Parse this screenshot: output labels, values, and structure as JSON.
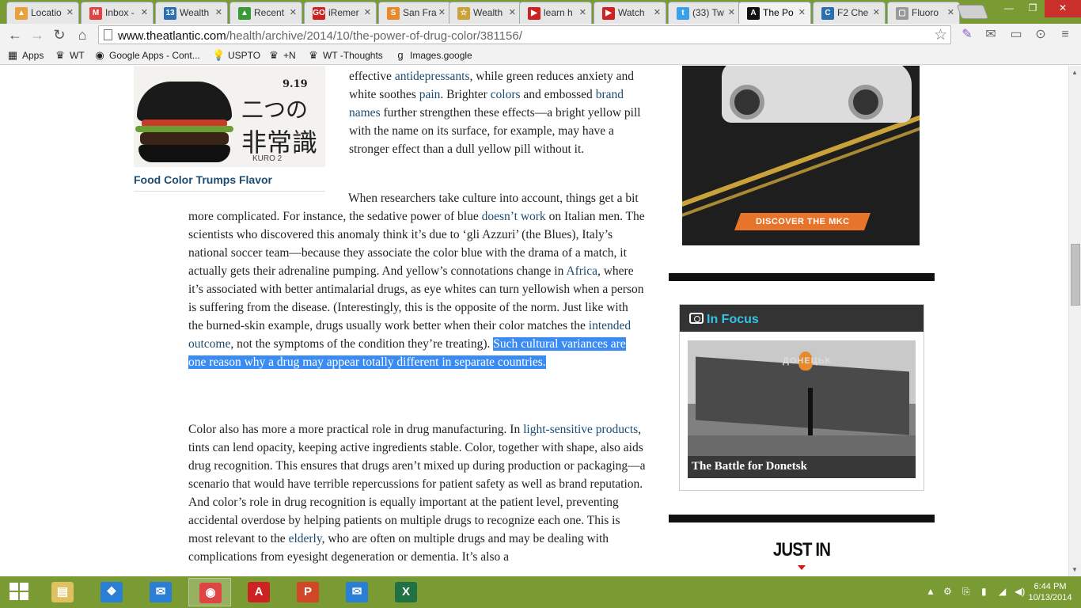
{
  "browser": {
    "tabs": [
      {
        "label": "Locatio",
        "fav_color": "#e8a23a",
        "fav_glyph": "▲"
      },
      {
        "label": "Inbox -",
        "fav_color": "#d44",
        "fav_glyph": "M"
      },
      {
        "label": "Wealth",
        "fav_color": "#2a6fb0",
        "fav_glyph": "13"
      },
      {
        "label": "Recent",
        "fav_color": "#3a9a3a",
        "fav_glyph": "▲"
      },
      {
        "label": "iRemer",
        "fav_color": "#c22",
        "fav_glyph": "GO"
      },
      {
        "label": "San Fra",
        "fav_color": "#e88a2a",
        "fav_glyph": "S"
      },
      {
        "label": "Wealth",
        "fav_color": "#caa23a",
        "fav_glyph": "☆"
      },
      {
        "label": "learn h",
        "fav_color": "#c22",
        "fav_glyph": "▶"
      },
      {
        "label": "Watch",
        "fav_color": "#c22",
        "fav_glyph": "▶"
      },
      {
        "label": "(33) Tw",
        "fav_color": "#3aa0e8",
        "fav_glyph": "t"
      },
      {
        "label": "The Po",
        "fav_color": "#111",
        "fav_glyph": "A",
        "active": true
      },
      {
        "label": "F2 Che",
        "fav_color": "#2a6fb0",
        "fav_glyph": "C"
      },
      {
        "label": "Fluoro",
        "fav_color": "#999",
        "fav_glyph": "▢"
      }
    ],
    "url_host": "www.theatlantic.com",
    "url_path": "/health/archive/2014/10/the-power-of-drug-color/381156/",
    "bookmarks": [
      {
        "label": "Apps",
        "icon": "apps-grid-icon",
        "glyph": "▦"
      },
      {
        "label": "WT",
        "icon": "crown-icon",
        "glyph": "♛"
      },
      {
        "label": "Google Apps - Cont...",
        "icon": "google-icon",
        "glyph": "◉"
      },
      {
        "label": "USPTO",
        "icon": "bulb-icon",
        "glyph": "💡"
      },
      {
        "label": "+N",
        "icon": "crown-icon",
        "glyph": "♛"
      },
      {
        "label": "WT -Thoughts",
        "icon": "crown-icon",
        "glyph": "♛"
      },
      {
        "label": "Images.google",
        "icon": "google-g-icon",
        "glyph": "g"
      }
    ]
  },
  "article": {
    "image_caption": "Food Color Trumps Flavor",
    "image_text": {
      "date": "9.19",
      "line1": "二つの",
      "line2": "非常識",
      "brand": "KURO 2"
    },
    "p1_a": "effective ",
    "p1_link1": "antidepressants",
    "p1_b": ", while green reduces anxiety and white soothes ",
    "p1_link2": "pain",
    "p1_c": ". Brighter ",
    "p1_link3": "colors",
    "p1_d": " and embossed ",
    "p1_link4": "brand names",
    "p1_e": " further strengthen these effects—a bright yellow pill with the name on its surface, for example, may have a stronger effect than a dull yellow pill without it.",
    "p2_a": "When researchers take culture into account, things get a bit more complicated. For instance, the sedative power of blue ",
    "p2_link1": "doesn’t work",
    "p2_b": " on Italian men. The scientists who discovered this anomaly think it’s due to ‘gli Azzuri’ (the Blues), Italy’s national soccer team—because they associate the color blue with the drama of a match, it actually gets their adrenaline pumping. And yellow’s connotations change in ",
    "p2_link2": "Africa",
    "p2_c": ", where it’s associated with better antimalarial drugs, as eye whites can turn yellowish when a person is suffering from the disease. (Interestingly, this is the opposite of the norm. Just like with the burned-skin example, drugs usually work better when their color matches the ",
    "p2_link3": "intended outcome",
    "p2_d": ", not the symptoms of the condition they’re treating). ",
    "p2_selected": "Such cultural variances are one reason why a drug may appear totally different in separate countries.",
    "p3_a": "Color also has more a more practical role in drug manufacturing. In ",
    "p3_link1": "light-sensitive products",
    "p3_b": ", tints can lend opacity, keeping active ingredients stable. Color, together with shape, also aids drug recognition. This ensures that drugs aren’t mixed up during production or packaging—a scenario that would have terrible repercussions for patient safety as well as brand reputation. And color’s role in drug recognition is equally important at the patient level, preventing accidental overdose by helping patients on multiple drugs to recognize each one. This is most relevant to the ",
    "p3_link2": "elderly",
    "p3_c": ", who are often on multiple drugs and may be dealing with complications from eyesight degeneration or dementia. It’s also a"
  },
  "sidebar": {
    "ad_cta": "DISCOVER THE MKC",
    "in_focus_title": "In Focus",
    "in_focus_photo_caption": "The Battle for Donetsk",
    "in_focus_sign_text": "ДОНЕЦЬК",
    "just_in_title": "JUST IN"
  },
  "taskbar": {
    "apps": [
      {
        "name": "file-explorer",
        "color": "#e0c060",
        "glyph": "▤"
      },
      {
        "name": "dropbox",
        "color": "#2a7fd4",
        "glyph": "❖"
      },
      {
        "name": "mail-app",
        "color": "#2a7fd4",
        "glyph": "✉"
      },
      {
        "name": "chrome",
        "color": "#d44",
        "glyph": "◉",
        "active": true
      },
      {
        "name": "acrobat",
        "color": "#c22",
        "glyph": "A"
      },
      {
        "name": "powerpoint",
        "color": "#d24726",
        "glyph": "P"
      },
      {
        "name": "mail-app-2",
        "color": "#2a7fd4",
        "glyph": "✉"
      },
      {
        "name": "excel",
        "color": "#207245",
        "glyph": "X"
      }
    ],
    "time": "6:44 PM",
    "date": "10/13/2014"
  }
}
